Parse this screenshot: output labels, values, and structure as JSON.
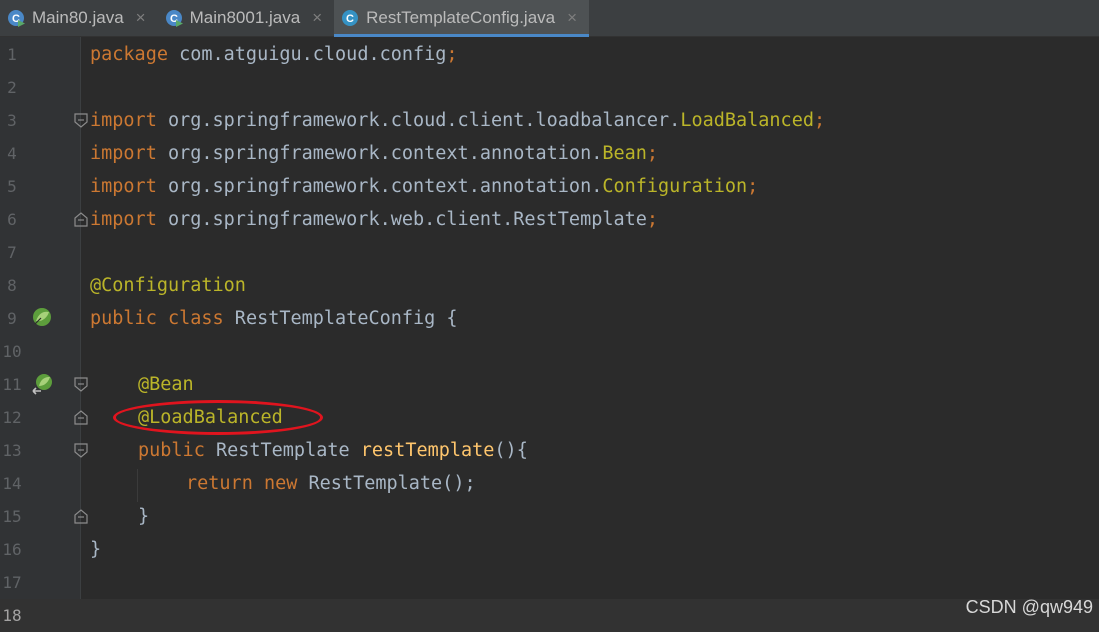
{
  "tabs": [
    {
      "label": "Main80.java",
      "icon": "java-class-run-icon",
      "active": false
    },
    {
      "label": "Main8001.java",
      "icon": "java-class-run-icon",
      "active": false
    },
    {
      "label": "RestTemplateConfig.java",
      "icon": "java-class-icon",
      "active": true
    }
  ],
  "close_glyph": "×",
  "line_numbers": [
    "1",
    "2",
    "3",
    "4",
    "5",
    "6",
    "7",
    "8",
    "9",
    "10",
    "11",
    "12",
    "13",
    "14",
    "15",
    "16",
    "17",
    "18"
  ],
  "code": {
    "l1": {
      "kw": "package",
      "rest": " com.atguigu.cloud.config",
      "semi": ";"
    },
    "l3": {
      "kw": "import",
      "rest": " org.springframework.cloud.client.loadbalancer.",
      "cls": "LoadBalanced",
      "semi": ";"
    },
    "l4": {
      "kw": "import",
      "rest": " org.springframework.context.annotation.",
      "cls": "Bean",
      "semi": ";"
    },
    "l5": {
      "kw": "import",
      "rest": " org.springframework.context.annotation.",
      "cls": "Configuration",
      "semi": ";"
    },
    "l6": {
      "kw": "import",
      "rest": " org.springframework.web.client.RestTemplate",
      "semi": ";"
    },
    "l8": {
      "ann": "@Configuration"
    },
    "l9": {
      "kw1": "public",
      "kw2": "class",
      "name": " RestTemplateConfig {"
    },
    "l11": {
      "ann": "@Bean"
    },
    "l12": {
      "ann": "@LoadBalanced"
    },
    "l13": {
      "kw": "public",
      "type": " RestTemplate ",
      "fn": "restTemplate",
      "rest": "(){"
    },
    "l14": {
      "kw1": "return",
      "kw2": "new",
      "rest": " RestTemplate();",
      "semi": ""
    },
    "l15": {
      "brace": "}"
    },
    "l16": {
      "brace": "}"
    }
  },
  "colors": {
    "keyword": "#cc7832",
    "annotation": "#bbb529",
    "method": "#ffc66d",
    "plain": "#a9b7c6",
    "highlight": "#e0141e",
    "tab_underline": "#4a88c7"
  },
  "watermark": "CSDN @qw949"
}
